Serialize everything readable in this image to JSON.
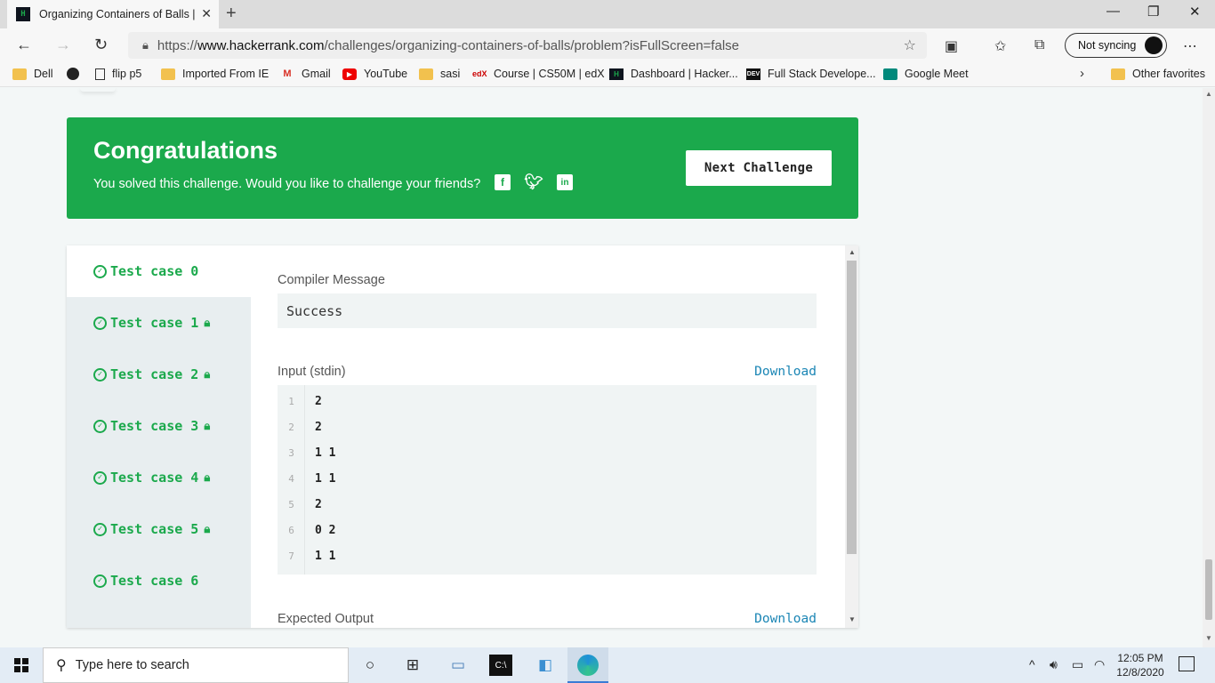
{
  "browser": {
    "tab_title": "Organizing Containers of Balls | HackerRank",
    "tab_favicon": "H",
    "url_prefix": "https://",
    "url_host": "www.hackerrank.com",
    "url_path": "/challenges/organizing-containers-of-balls/problem?isFullScreen=false",
    "sync_label": "Not syncing",
    "favorites": [
      {
        "label": "Dell",
        "icon": "folder-icon"
      },
      {
        "label": "",
        "icon": "github-icon"
      },
      {
        "label": "flip p5",
        "icon": "page-icon"
      },
      {
        "label": "Imported From IE",
        "icon": "folder-icon"
      },
      {
        "label": "Gmail",
        "icon": "gmail-icon"
      },
      {
        "label": "YouTube",
        "icon": "youtube-icon"
      },
      {
        "label": "sasi",
        "icon": "folder-icon"
      },
      {
        "label": "Course | CS50M | edX",
        "icon": "edx-icon"
      },
      {
        "label": "Dashboard | Hacker...",
        "icon": "hackerrank-icon"
      },
      {
        "label": "Full Stack Develope...",
        "icon": "dev-icon"
      },
      {
        "label": "Google Meet",
        "icon": "meet-icon"
      }
    ],
    "other_favorites": "Other favorites"
  },
  "banner": {
    "title": "Congratulations",
    "message": "You solved this challenge. Would you like to challenge your friends?",
    "next_button": "Next Challenge",
    "brand_color": "#1ba94c"
  },
  "test_cases": [
    {
      "label": "Test case 0",
      "locked": false,
      "active": true
    },
    {
      "label": "Test case 1",
      "locked": true,
      "active": false
    },
    {
      "label": "Test case 2",
      "locked": true,
      "active": false
    },
    {
      "label": "Test case 3",
      "locked": true,
      "active": false
    },
    {
      "label": "Test case 4",
      "locked": true,
      "active": false
    },
    {
      "label": "Test case 5",
      "locked": true,
      "active": false
    },
    {
      "label": "Test case 6",
      "locked": false,
      "active": false
    }
  ],
  "result": {
    "compiler_label": "Compiler Message",
    "compiler_message": "Success",
    "input_label": "Input (stdin)",
    "download_label": "Download",
    "input_lines": [
      {
        "n": "1",
        "text": "2"
      },
      {
        "n": "2",
        "text": "2"
      },
      {
        "n": "3",
        "text": "1 1"
      },
      {
        "n": "4",
        "text": "1 1"
      },
      {
        "n": "5",
        "text": "2"
      },
      {
        "n": "6",
        "text": "0 2"
      },
      {
        "n": "7",
        "text": "1 1"
      }
    ],
    "expected_label": "Expected Output",
    "expected_download": "Download"
  },
  "taskbar": {
    "search_placeholder": "Type here to search",
    "time": "12:05 PM",
    "date": "12/8/2020"
  }
}
